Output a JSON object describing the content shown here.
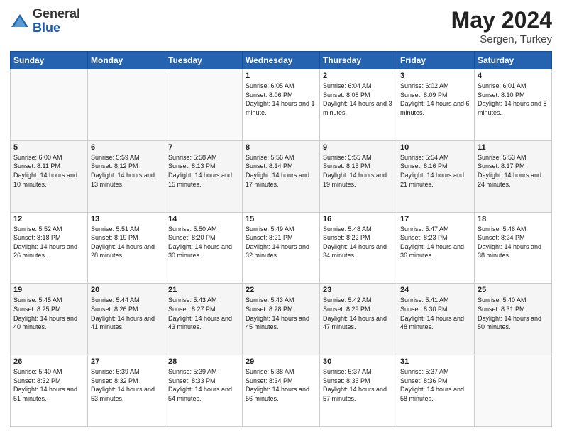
{
  "logo": {
    "general": "General",
    "blue": "Blue"
  },
  "header": {
    "title": "May 2024",
    "subtitle": "Sergen, Turkey"
  },
  "weekdays": [
    "Sunday",
    "Monday",
    "Tuesday",
    "Wednesday",
    "Thursday",
    "Friday",
    "Saturday"
  ],
  "weeks": [
    [
      {
        "day": "",
        "sunrise": "",
        "sunset": "",
        "daylight": ""
      },
      {
        "day": "",
        "sunrise": "",
        "sunset": "",
        "daylight": ""
      },
      {
        "day": "",
        "sunrise": "",
        "sunset": "",
        "daylight": ""
      },
      {
        "day": "1",
        "sunrise": "Sunrise: 6:05 AM",
        "sunset": "Sunset: 8:06 PM",
        "daylight": "Daylight: 14 hours and 1 minute."
      },
      {
        "day": "2",
        "sunrise": "Sunrise: 6:04 AM",
        "sunset": "Sunset: 8:08 PM",
        "daylight": "Daylight: 14 hours and 3 minutes."
      },
      {
        "day": "3",
        "sunrise": "Sunrise: 6:02 AM",
        "sunset": "Sunset: 8:09 PM",
        "daylight": "Daylight: 14 hours and 6 minutes."
      },
      {
        "day": "4",
        "sunrise": "Sunrise: 6:01 AM",
        "sunset": "Sunset: 8:10 PM",
        "daylight": "Daylight: 14 hours and 8 minutes."
      }
    ],
    [
      {
        "day": "5",
        "sunrise": "Sunrise: 6:00 AM",
        "sunset": "Sunset: 8:11 PM",
        "daylight": "Daylight: 14 hours and 10 minutes."
      },
      {
        "day": "6",
        "sunrise": "Sunrise: 5:59 AM",
        "sunset": "Sunset: 8:12 PM",
        "daylight": "Daylight: 14 hours and 13 minutes."
      },
      {
        "day": "7",
        "sunrise": "Sunrise: 5:58 AM",
        "sunset": "Sunset: 8:13 PM",
        "daylight": "Daylight: 14 hours and 15 minutes."
      },
      {
        "day": "8",
        "sunrise": "Sunrise: 5:56 AM",
        "sunset": "Sunset: 8:14 PM",
        "daylight": "Daylight: 14 hours and 17 minutes."
      },
      {
        "day": "9",
        "sunrise": "Sunrise: 5:55 AM",
        "sunset": "Sunset: 8:15 PM",
        "daylight": "Daylight: 14 hours and 19 minutes."
      },
      {
        "day": "10",
        "sunrise": "Sunrise: 5:54 AM",
        "sunset": "Sunset: 8:16 PM",
        "daylight": "Daylight: 14 hours and 21 minutes."
      },
      {
        "day": "11",
        "sunrise": "Sunrise: 5:53 AM",
        "sunset": "Sunset: 8:17 PM",
        "daylight": "Daylight: 14 hours and 24 minutes."
      }
    ],
    [
      {
        "day": "12",
        "sunrise": "Sunrise: 5:52 AM",
        "sunset": "Sunset: 8:18 PM",
        "daylight": "Daylight: 14 hours and 26 minutes."
      },
      {
        "day": "13",
        "sunrise": "Sunrise: 5:51 AM",
        "sunset": "Sunset: 8:19 PM",
        "daylight": "Daylight: 14 hours and 28 minutes."
      },
      {
        "day": "14",
        "sunrise": "Sunrise: 5:50 AM",
        "sunset": "Sunset: 8:20 PM",
        "daylight": "Daylight: 14 hours and 30 minutes."
      },
      {
        "day": "15",
        "sunrise": "Sunrise: 5:49 AM",
        "sunset": "Sunset: 8:21 PM",
        "daylight": "Daylight: 14 hours and 32 minutes."
      },
      {
        "day": "16",
        "sunrise": "Sunrise: 5:48 AM",
        "sunset": "Sunset: 8:22 PM",
        "daylight": "Daylight: 14 hours and 34 minutes."
      },
      {
        "day": "17",
        "sunrise": "Sunrise: 5:47 AM",
        "sunset": "Sunset: 8:23 PM",
        "daylight": "Daylight: 14 hours and 36 minutes."
      },
      {
        "day": "18",
        "sunrise": "Sunrise: 5:46 AM",
        "sunset": "Sunset: 8:24 PM",
        "daylight": "Daylight: 14 hours and 38 minutes."
      }
    ],
    [
      {
        "day": "19",
        "sunrise": "Sunrise: 5:45 AM",
        "sunset": "Sunset: 8:25 PM",
        "daylight": "Daylight: 14 hours and 40 minutes."
      },
      {
        "day": "20",
        "sunrise": "Sunrise: 5:44 AM",
        "sunset": "Sunset: 8:26 PM",
        "daylight": "Daylight: 14 hours and 41 minutes."
      },
      {
        "day": "21",
        "sunrise": "Sunrise: 5:43 AM",
        "sunset": "Sunset: 8:27 PM",
        "daylight": "Daylight: 14 hours and 43 minutes."
      },
      {
        "day": "22",
        "sunrise": "Sunrise: 5:43 AM",
        "sunset": "Sunset: 8:28 PM",
        "daylight": "Daylight: 14 hours and 45 minutes."
      },
      {
        "day": "23",
        "sunrise": "Sunrise: 5:42 AM",
        "sunset": "Sunset: 8:29 PM",
        "daylight": "Daylight: 14 hours and 47 minutes."
      },
      {
        "day": "24",
        "sunrise": "Sunrise: 5:41 AM",
        "sunset": "Sunset: 8:30 PM",
        "daylight": "Daylight: 14 hours and 48 minutes."
      },
      {
        "day": "25",
        "sunrise": "Sunrise: 5:40 AM",
        "sunset": "Sunset: 8:31 PM",
        "daylight": "Daylight: 14 hours and 50 minutes."
      }
    ],
    [
      {
        "day": "26",
        "sunrise": "Sunrise: 5:40 AM",
        "sunset": "Sunset: 8:32 PM",
        "daylight": "Daylight: 14 hours and 51 minutes."
      },
      {
        "day": "27",
        "sunrise": "Sunrise: 5:39 AM",
        "sunset": "Sunset: 8:32 PM",
        "daylight": "Daylight: 14 hours and 53 minutes."
      },
      {
        "day": "28",
        "sunrise": "Sunrise: 5:39 AM",
        "sunset": "Sunset: 8:33 PM",
        "daylight": "Daylight: 14 hours and 54 minutes."
      },
      {
        "day": "29",
        "sunrise": "Sunrise: 5:38 AM",
        "sunset": "Sunset: 8:34 PM",
        "daylight": "Daylight: 14 hours and 56 minutes."
      },
      {
        "day": "30",
        "sunrise": "Sunrise: 5:37 AM",
        "sunset": "Sunset: 8:35 PM",
        "daylight": "Daylight: 14 hours and 57 minutes."
      },
      {
        "day": "31",
        "sunrise": "Sunrise: 5:37 AM",
        "sunset": "Sunset: 8:36 PM",
        "daylight": "Daylight: 14 hours and 58 minutes."
      },
      {
        "day": "",
        "sunrise": "",
        "sunset": "",
        "daylight": ""
      }
    ]
  ]
}
